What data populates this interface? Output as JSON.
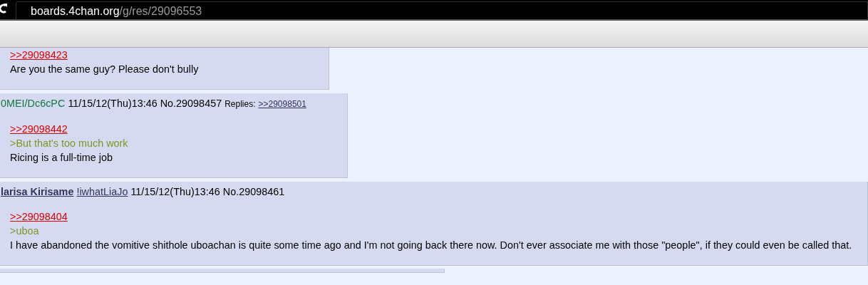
{
  "browser": {
    "url_host": "boards.4chan.org",
    "url_path": "/g/res/29096553"
  },
  "posts": [
    {
      "lines": [
        {
          "kind": "quotelink",
          "text": ">>29098423"
        },
        {
          "kind": "text",
          "text": "Are you the same guy? Please don't bully"
        }
      ]
    },
    {
      "tripcode": "0MEI/Dc6cPC",
      "email_link": false,
      "date_no": "11/15/12(Thu)13:46 No.29098457",
      "replies_label": "Replies:",
      "replies": [
        ">>29098501"
      ],
      "lines": [
        {
          "kind": "quotelink",
          "text": ">>29098442"
        },
        {
          "kind": "greentext",
          "text": ">But that's too much work"
        },
        {
          "kind": "text",
          "text": "Ricing is a full-time job"
        }
      ]
    },
    {
      "name": "larisa Kirisame",
      "tripcode": "!iwhatLiaJo",
      "email_link": true,
      "date_no": "11/15/12(Thu)13:46 No.29098461",
      "lines": [
        {
          "kind": "quotelink",
          "text": ">>29098404"
        },
        {
          "kind": "greentext",
          "text": ">uboa"
        },
        {
          "kind": "text",
          "text": "I have abandoned the vomitive shithole uboachan is quite some time ago and I'm not going back there now. Don't ever associate me with those \"people\", if they could even be called that."
        }
      ]
    }
  ]
}
